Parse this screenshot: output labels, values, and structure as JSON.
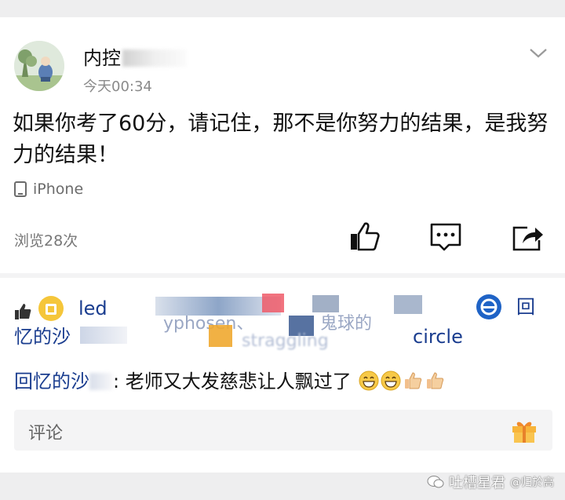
{
  "post": {
    "username": "内控",
    "time": "今天00:34",
    "text": "如果你考了60分，请记住，那不是你努力的结果，是我努力的结果！",
    "source": "iPhone",
    "views": "浏览28次"
  },
  "likes": {
    "fragments": [
      "回",
      "忆的沙",
      "circle",
      "led",
      "yphosen、",
      "鬼球的",
      "straggling"
    ]
  },
  "comment": {
    "author": "回忆的沙",
    "text": ": 老师又大发慈悲让人飘过了"
  },
  "comment_input": {
    "placeholder": "评论"
  },
  "watermark": {
    "text": "吐槽星君",
    "sub": "@归於高"
  },
  "colors": {
    "accent": "#1a3d8f",
    "background": "#eeeeef",
    "muted": "#8a8a8a"
  }
}
